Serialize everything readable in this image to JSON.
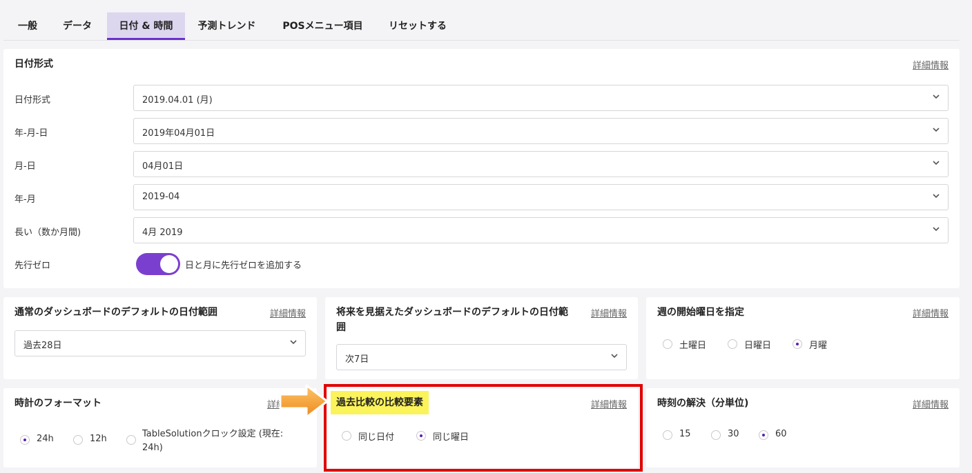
{
  "tabs": [
    {
      "label": "一般"
    },
    {
      "label": "データ"
    },
    {
      "label": "日付 & 時間"
    },
    {
      "label": "予測トレンド"
    },
    {
      "label": "POSメニュー項目"
    },
    {
      "label": "リセットする"
    }
  ],
  "date_format": {
    "title": "日付形式",
    "more": "詳細情報",
    "rows": [
      {
        "label": "日付形式",
        "value": "2019.04.01 (月)"
      },
      {
        "label": "年-月-日",
        "value": "2019年04月01日"
      },
      {
        "label": "月-日",
        "value": "04月01日"
      },
      {
        "label": "年-月",
        "value": "2019-04"
      },
      {
        "label": "長い（数か月間)",
        "value": "4月 2019"
      }
    ],
    "leading_zero_label": "先行ゼロ",
    "leading_zero_text": "日と月に先行ゼロを追加する",
    "leading_zero_on": true
  },
  "dash_default": {
    "title": "通常のダッシュボードのデフォルトの日付範囲",
    "more": "詳細情報",
    "value": "過去28日"
  },
  "future_default": {
    "title": "将来を見据えたダッシュボードのデフォルトの日付範囲",
    "more": "詳細情報",
    "value": "次7日"
  },
  "week_start": {
    "title": "週の開始曜日を指定",
    "more": "詳細情報",
    "options": [
      {
        "label": "土曜日",
        "selected": false
      },
      {
        "label": "日曜日",
        "selected": false
      },
      {
        "label": "月曜",
        "selected": true
      }
    ]
  },
  "clock_format": {
    "title": "時計のフォーマット",
    "more": "詳細情報",
    "options": [
      {
        "label": "24h",
        "selected": true
      },
      {
        "label": "12h",
        "selected": false
      },
      {
        "label": "TableSolutionクロック設定 (現在: 24h)",
        "selected": false
      }
    ]
  },
  "comparison": {
    "title": "過去比較の比較要素",
    "more": "詳細情報",
    "options": [
      {
        "label": "同じ日付",
        "selected": false
      },
      {
        "label": "同じ曜日",
        "selected": true
      }
    ]
  },
  "time_resolution": {
    "title": "時刻の解決（分単位)",
    "more": "詳細情報",
    "options": [
      {
        "label": "15",
        "selected": false
      },
      {
        "label": "30",
        "selected": false
      },
      {
        "label": "60",
        "selected": true
      }
    ]
  },
  "colors": {
    "accent": "#7b3fd0",
    "tab_active_bg": "#ddd6ef",
    "highlight": "#fbf35a",
    "annotation_red": "#e20000",
    "arrow": "#f7a234"
  }
}
